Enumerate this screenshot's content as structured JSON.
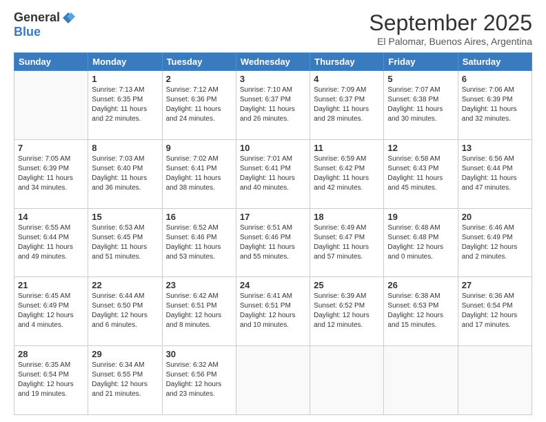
{
  "logo": {
    "general": "General",
    "blue": "Blue"
  },
  "title": "September 2025",
  "subtitle": "El Palomar, Buenos Aires, Argentina",
  "weekdays": [
    "Sunday",
    "Monday",
    "Tuesday",
    "Wednesday",
    "Thursday",
    "Friday",
    "Saturday"
  ],
  "weeks": [
    [
      {
        "day": "",
        "info": ""
      },
      {
        "day": "1",
        "info": "Sunrise: 7:13 AM\nSunset: 6:35 PM\nDaylight: 11 hours\nand 22 minutes."
      },
      {
        "day": "2",
        "info": "Sunrise: 7:12 AM\nSunset: 6:36 PM\nDaylight: 11 hours\nand 24 minutes."
      },
      {
        "day": "3",
        "info": "Sunrise: 7:10 AM\nSunset: 6:37 PM\nDaylight: 11 hours\nand 26 minutes."
      },
      {
        "day": "4",
        "info": "Sunrise: 7:09 AM\nSunset: 6:37 PM\nDaylight: 11 hours\nand 28 minutes."
      },
      {
        "day": "5",
        "info": "Sunrise: 7:07 AM\nSunset: 6:38 PM\nDaylight: 11 hours\nand 30 minutes."
      },
      {
        "day": "6",
        "info": "Sunrise: 7:06 AM\nSunset: 6:39 PM\nDaylight: 11 hours\nand 32 minutes."
      }
    ],
    [
      {
        "day": "7",
        "info": "Sunrise: 7:05 AM\nSunset: 6:39 PM\nDaylight: 11 hours\nand 34 minutes."
      },
      {
        "day": "8",
        "info": "Sunrise: 7:03 AM\nSunset: 6:40 PM\nDaylight: 11 hours\nand 36 minutes."
      },
      {
        "day": "9",
        "info": "Sunrise: 7:02 AM\nSunset: 6:41 PM\nDaylight: 11 hours\nand 38 minutes."
      },
      {
        "day": "10",
        "info": "Sunrise: 7:01 AM\nSunset: 6:41 PM\nDaylight: 11 hours\nand 40 minutes."
      },
      {
        "day": "11",
        "info": "Sunrise: 6:59 AM\nSunset: 6:42 PM\nDaylight: 11 hours\nand 42 minutes."
      },
      {
        "day": "12",
        "info": "Sunrise: 6:58 AM\nSunset: 6:43 PM\nDaylight: 11 hours\nand 45 minutes."
      },
      {
        "day": "13",
        "info": "Sunrise: 6:56 AM\nSunset: 6:44 PM\nDaylight: 11 hours\nand 47 minutes."
      }
    ],
    [
      {
        "day": "14",
        "info": "Sunrise: 6:55 AM\nSunset: 6:44 PM\nDaylight: 11 hours\nand 49 minutes."
      },
      {
        "day": "15",
        "info": "Sunrise: 6:53 AM\nSunset: 6:45 PM\nDaylight: 11 hours\nand 51 minutes."
      },
      {
        "day": "16",
        "info": "Sunrise: 6:52 AM\nSunset: 6:46 PM\nDaylight: 11 hours\nand 53 minutes."
      },
      {
        "day": "17",
        "info": "Sunrise: 6:51 AM\nSunset: 6:46 PM\nDaylight: 11 hours\nand 55 minutes."
      },
      {
        "day": "18",
        "info": "Sunrise: 6:49 AM\nSunset: 6:47 PM\nDaylight: 11 hours\nand 57 minutes."
      },
      {
        "day": "19",
        "info": "Sunrise: 6:48 AM\nSunset: 6:48 PM\nDaylight: 12 hours\nand 0 minutes."
      },
      {
        "day": "20",
        "info": "Sunrise: 6:46 AM\nSunset: 6:49 PM\nDaylight: 12 hours\nand 2 minutes."
      }
    ],
    [
      {
        "day": "21",
        "info": "Sunrise: 6:45 AM\nSunset: 6:49 PM\nDaylight: 12 hours\nand 4 minutes."
      },
      {
        "day": "22",
        "info": "Sunrise: 6:44 AM\nSunset: 6:50 PM\nDaylight: 12 hours\nand 6 minutes."
      },
      {
        "day": "23",
        "info": "Sunrise: 6:42 AM\nSunset: 6:51 PM\nDaylight: 12 hours\nand 8 minutes."
      },
      {
        "day": "24",
        "info": "Sunrise: 6:41 AM\nSunset: 6:51 PM\nDaylight: 12 hours\nand 10 minutes."
      },
      {
        "day": "25",
        "info": "Sunrise: 6:39 AM\nSunset: 6:52 PM\nDaylight: 12 hours\nand 12 minutes."
      },
      {
        "day": "26",
        "info": "Sunrise: 6:38 AM\nSunset: 6:53 PM\nDaylight: 12 hours\nand 15 minutes."
      },
      {
        "day": "27",
        "info": "Sunrise: 6:36 AM\nSunset: 6:54 PM\nDaylight: 12 hours\nand 17 minutes."
      }
    ],
    [
      {
        "day": "28",
        "info": "Sunrise: 6:35 AM\nSunset: 6:54 PM\nDaylight: 12 hours\nand 19 minutes."
      },
      {
        "day": "29",
        "info": "Sunrise: 6:34 AM\nSunset: 6:55 PM\nDaylight: 12 hours\nand 21 minutes."
      },
      {
        "day": "30",
        "info": "Sunrise: 6:32 AM\nSunset: 6:56 PM\nDaylight: 12 hours\nand 23 minutes."
      },
      {
        "day": "",
        "info": ""
      },
      {
        "day": "",
        "info": ""
      },
      {
        "day": "",
        "info": ""
      },
      {
        "day": "",
        "info": ""
      }
    ]
  ]
}
